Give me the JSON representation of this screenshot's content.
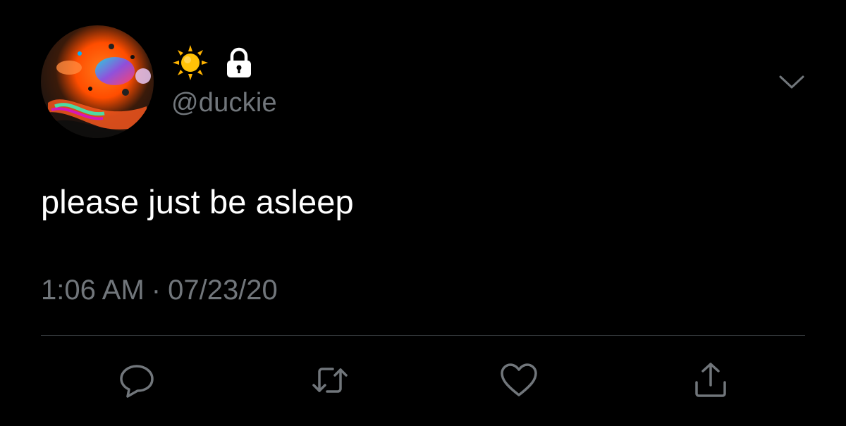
{
  "tweet": {
    "handle": "@duckie",
    "name_emoji": [
      "sun-icon"
    ],
    "protected": true,
    "text": "please just be asleep",
    "time": "1:06 AM",
    "separator": "·",
    "date": "07/23/20"
  },
  "actions": [
    {
      "icon": "reply-icon"
    },
    {
      "icon": "retweet-icon"
    },
    {
      "icon": "like-icon"
    },
    {
      "icon": "share-icon"
    }
  ],
  "colors": {
    "background": "#000000",
    "text_primary": "#ffffff",
    "text_secondary": "#71767b",
    "divider": "#2f3336",
    "sun": "#ffb300"
  }
}
